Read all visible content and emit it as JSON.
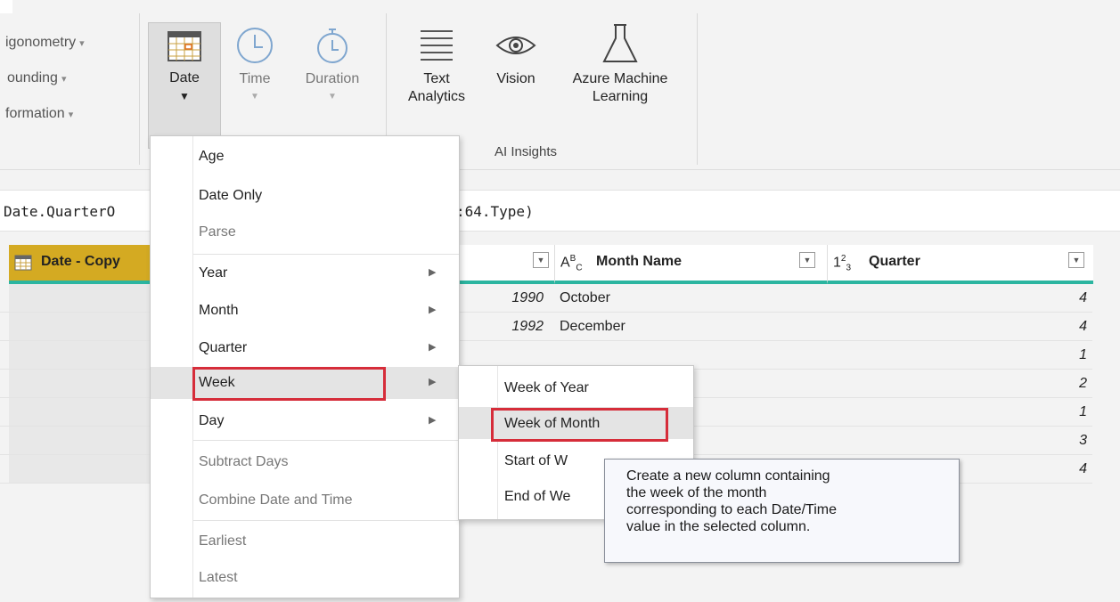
{
  "ribbon": {
    "left_items": [
      "igonometry",
      "ounding",
      "formation"
    ],
    "buttons": {
      "date": "Date",
      "time": "Time",
      "duration": "Duration",
      "text_analytics_line1": "Text",
      "text_analytics_line2": "Analytics",
      "vision": "Vision",
      "azure_line1": "Azure Machine",
      "azure_line2": "Learning"
    },
    "ai_group_label": "AI Insights"
  },
  "formula": {
    "left": "Date.QuarterO",
    "right": ":64.Type)"
  },
  "table": {
    "col_date_copy": "Date - Copy",
    "col_month_name": "Month Name",
    "col_quarter": "Quarter",
    "rows": [
      {
        "year": "1990",
        "month": "October",
        "quarter": "4"
      },
      {
        "year": "1992",
        "month": "December",
        "quarter": "4"
      },
      {
        "year": "",
        "month": "",
        "quarter": "1"
      },
      {
        "year": "",
        "month": "",
        "quarter": "2"
      },
      {
        "year": "",
        "month": "",
        "quarter": "1"
      },
      {
        "year": "",
        "month": "",
        "quarter": "3"
      },
      {
        "year": "",
        "month": "",
        "quarter": "4"
      }
    ]
  },
  "date_menu": {
    "items": [
      "Age",
      "Date Only",
      "Parse",
      "Year",
      "Month",
      "Quarter",
      "Week",
      "Day",
      "Subtract Days",
      "Combine Date and Time",
      "Earliest",
      "Latest"
    ]
  },
  "week_submenu": {
    "items": [
      "Week of Year",
      "Week of Month",
      "Start of W",
      "End of We"
    ]
  },
  "tooltip": {
    "lines": [
      "Create a new column containing",
      "the week of the month",
      "corresponding to each Date/Time",
      "value in the selected column."
    ]
  },
  "colors": {
    "accent_teal": "#2bb5a0",
    "highlight_red": "#d62d3a",
    "header_gold": "#d4aa22"
  }
}
